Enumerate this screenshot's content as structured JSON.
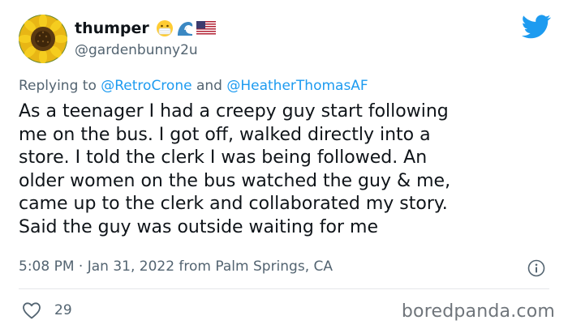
{
  "user": {
    "display_name": "thumper",
    "handle": "@gardenbunny2u",
    "avatar_icon": "sunflower-avatar",
    "name_emojis": [
      "face-with-mask-emoji",
      "water-wave-emoji",
      "us-flag-emoji"
    ]
  },
  "reply": {
    "prefix": "Replying to",
    "mention_1": "@RetroCrone",
    "joiner": "and",
    "mention_2": "@HeatherThomasAF"
  },
  "tweet": {
    "text": "As a teenager I had a creepy guy start following\nme on the bus. I got off, walked directly into a\nstore. I told the clerk I was being followed. An\nolder women on the bus watched the guy & me,\ncame up to the clerk and collaborated my story.\nSaid the guy was outside waiting for me"
  },
  "meta": {
    "timestamp": "5:08 PM · Jan 31, 2022 from Palm Springs, CA"
  },
  "engagement": {
    "likes": "29"
  },
  "watermark": "boredpanda.com",
  "colors": {
    "accent": "#1d9bf0",
    "secondary_text": "#536471",
    "primary_text": "#0f1419"
  }
}
